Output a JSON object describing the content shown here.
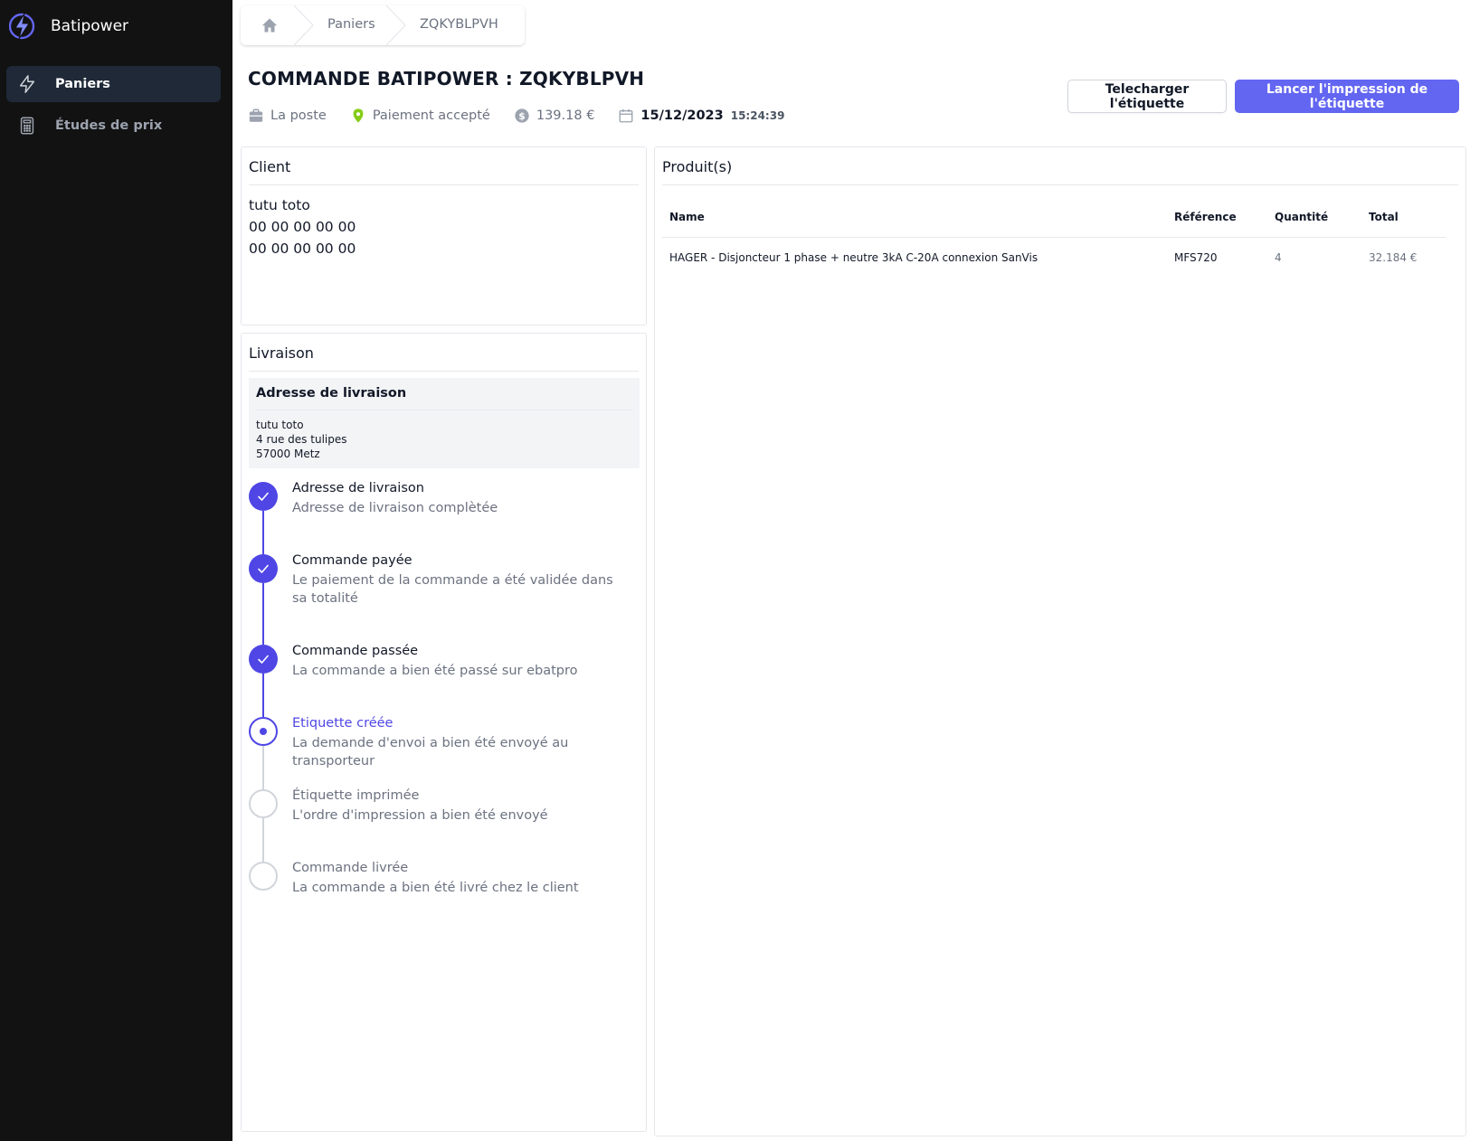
{
  "app": {
    "name": "Batipower"
  },
  "sidebar": {
    "items": [
      {
        "label": "Paniers",
        "icon": "bolt-icon",
        "active": true
      },
      {
        "label": "Études de prix",
        "icon": "calculator-icon",
        "active": false
      }
    ]
  },
  "breadcrumb": {
    "home_icon": "home-icon",
    "items": [
      "Paniers",
      "ZQKYBLPVH"
    ]
  },
  "header": {
    "title": "COMMANDE BATIPOWER : ZQKYBLPVH",
    "carrier": "La poste",
    "payment_status": "Paiement accepté",
    "amount": "139.18 €",
    "date": "15/12/2023",
    "time": "15:24:39",
    "download_label": "Telecharger l'étiquette",
    "print_label": "Lancer l'impression de l'étiquette"
  },
  "client": {
    "title": "Client",
    "name": "tutu toto",
    "phone1": "00 00 00 00 00",
    "phone2": "00 00 00 00 00"
  },
  "delivery": {
    "title": "Livraison",
    "address_title": "Adresse de livraison",
    "address_lines": [
      "tutu toto",
      "4 rue des tulipes",
      "57000 Metz"
    ],
    "steps": [
      {
        "title": "Adresse de livraison",
        "desc": "Adresse de livraison complètée",
        "status": "done"
      },
      {
        "title": "Commande payée",
        "desc": "Le paiement de la commande a été validée dans sa totalité",
        "status": "done"
      },
      {
        "title": "Commande passée",
        "desc": "La commande a bien été passé sur ebatpro",
        "status": "done"
      },
      {
        "title": "Etiquette créée",
        "desc": "La demande d'envoi a bien été envoyé au transporteur",
        "status": "current"
      },
      {
        "title": "Étiquette imprimée",
        "desc": "L'ordre d'impression a bien été envoyé",
        "status": "todo"
      },
      {
        "title": "Commande livrée",
        "desc": "La commande a bien été livré chez le client",
        "status": "todo"
      }
    ]
  },
  "products": {
    "title": "Produit(s)",
    "columns": [
      "Name",
      "Référence",
      "Quantité",
      "Total"
    ],
    "rows": [
      [
        "HAGER - Disjoncteur 1 phase + neutre 3kA C-20A connexion SanVis",
        "MFS720",
        "4",
        "32.184 €"
      ]
    ]
  },
  "colors": {
    "sidebar_bg": "#121212",
    "accent": "#6366f1",
    "step_done": "#4f46e5",
    "payment_ok": "#84cc16"
  }
}
